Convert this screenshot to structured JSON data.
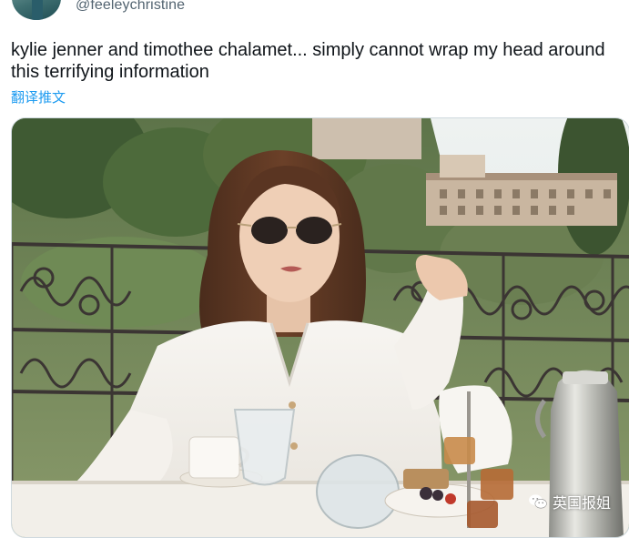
{
  "tweet": {
    "handle": "@feeleychristine",
    "text": "kylie jenner and timothee chalamet... simply cannot wrap my head around this terrifying information",
    "translate_label": "翻译推文"
  },
  "watermark": {
    "icon": "wechat-icon",
    "label": "英国报姐"
  },
  "colors": {
    "handle": "#536471",
    "link": "#1d9bf0",
    "text": "#0f1419"
  }
}
